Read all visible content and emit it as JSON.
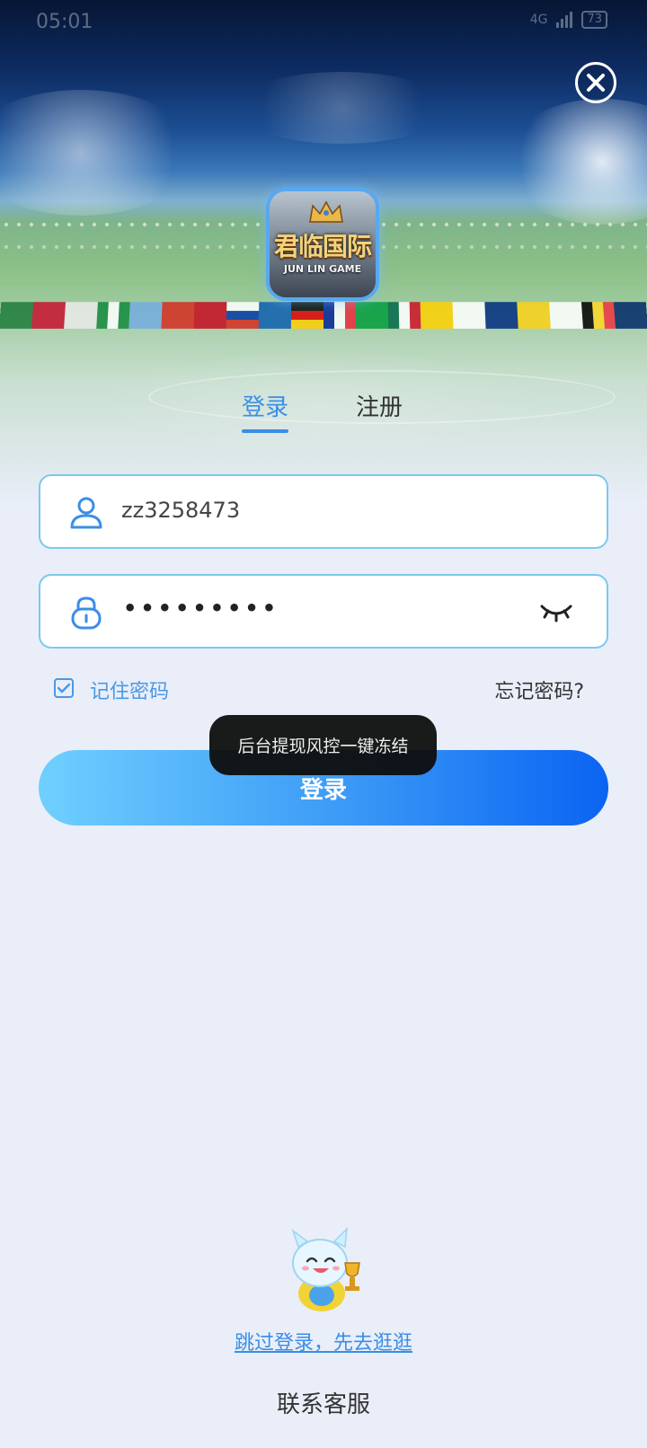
{
  "status_bar": {
    "time": "05:01",
    "network_label": "4G",
    "battery": "73"
  },
  "app_logo": {
    "title": "君临国际",
    "subtitle": "JUN LIN GAME"
  },
  "tabs": [
    {
      "label": "登录",
      "active": true
    },
    {
      "label": "注册",
      "active": false
    }
  ],
  "form": {
    "username_value": "zz3258473",
    "password_masked": "•••••••••",
    "remember_label": "记住密码",
    "remember_checked": true,
    "forgot_label": "忘记密码?",
    "login_button": "登录"
  },
  "toast": "后台提现风控一键冻结",
  "footer": {
    "skip_link": "跳过登录，先去逛逛",
    "contact": "联系客服"
  },
  "colors": {
    "accent": "#3a8ee6",
    "field_border": "#7cc8ec",
    "page_bg": "#e9eef9"
  }
}
